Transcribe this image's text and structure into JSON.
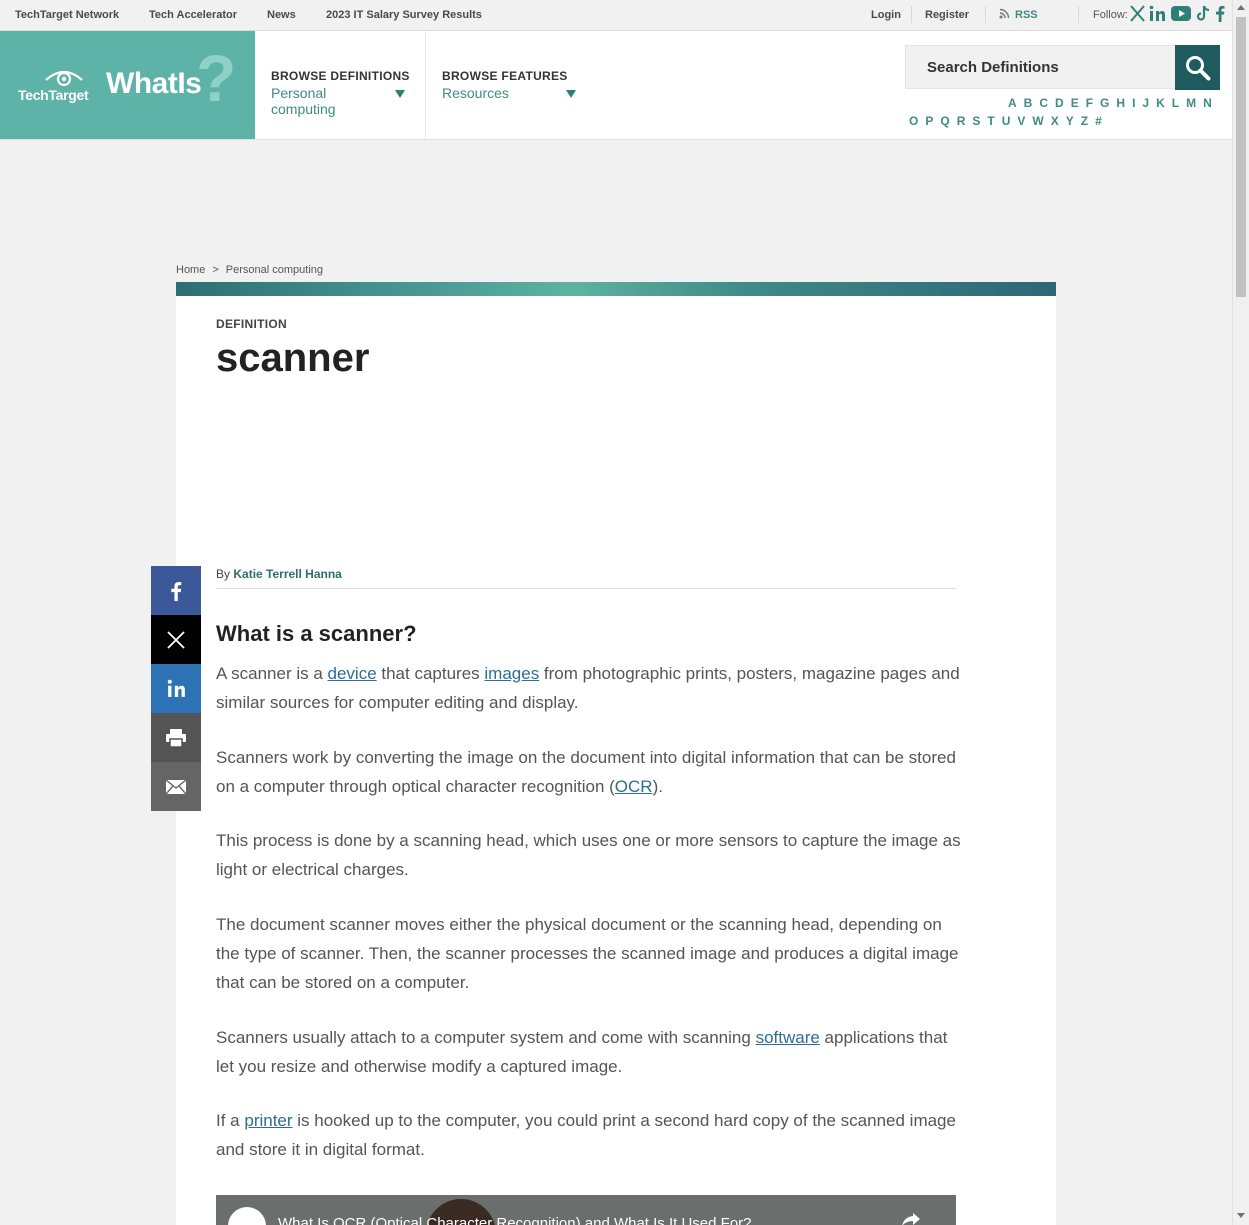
{
  "topbar": {
    "network": "TechTarget Network",
    "accelerator": "Tech Accelerator",
    "news": "News",
    "salary": "2023 IT Salary Survey Results",
    "login": "Login",
    "register": "Register",
    "rss": "RSS",
    "follow": "Follow:"
  },
  "header": {
    "brand": "TechTarget",
    "site": "WhatIs",
    "site_mark": "?",
    "browse_definitions_label": "BROWSE DEFINITIONS",
    "browse_definitions_value_1": "Personal",
    "browse_definitions_value_2": "computing",
    "browse_features_label": "BROWSE FEATURES",
    "browse_features_value": "Resources",
    "search_placeholder": "Search Definitions",
    "alpha_row1": [
      "A",
      "B",
      "C",
      "D",
      "E",
      "F",
      "G",
      "H",
      "I",
      "J",
      "K",
      "L",
      "M",
      "N"
    ],
    "alpha_row2": [
      "O",
      "P",
      "Q",
      "R",
      "S",
      "T",
      "U",
      "V",
      "W",
      "X",
      "Y",
      "Z",
      "#"
    ]
  },
  "breadcrumb": {
    "home": "Home",
    "sep": ">",
    "current": "Personal computing"
  },
  "article": {
    "kicker": "DEFINITION",
    "title": "scanner",
    "by": "By",
    "author": "Katie Terrell Hanna",
    "heading": "What is a scanner?",
    "p1": {
      "a": "A scanner is a ",
      "l1": "device",
      "b": " that captures ",
      "l2": "images",
      "c": " from photographic prints, posters, magazine pages and similar sources for computer editing and display."
    },
    "p2": {
      "a": "Scanners work by converting the image on the document into digital information that can be stored on a computer through optical character recognition (",
      "l1": "OCR",
      "b": ")."
    },
    "p3": "This process is done by a scanning head, which uses one or more sensors to capture the image as light or electrical charges.",
    "p4": "The document scanner moves either the physical document or the scanning head, depending on the type of scanner. Then, the scanner processes the scanned image and produces a digital image that can be stored on a computer.",
    "p5": {
      "a": "Scanners usually attach to a computer system and come with scanning ",
      "l1": "software",
      "b": " applications that let you resize and otherwise modify a captured image."
    },
    "p6": {
      "a": "If a ",
      "l1": "printer",
      "b": " is hooked up to the computer, you could print a second hard copy of the scanned image and store it in digital format."
    },
    "video_title": "What Is OCR (Optical Character Recognition) and What Is It Used For?"
  },
  "share": [
    "facebook-icon",
    "x-icon",
    "linkedin-icon",
    "print-icon",
    "email-icon"
  ],
  "colors": {
    "brand_teal": "#5db3a8",
    "search_button": "#1e5a5e",
    "link": "#2d6d96",
    "facebook": "#3b5998",
    "x": "#000000",
    "linkedin": "#2d72b5",
    "print": "#545454",
    "email": "#656565"
  }
}
